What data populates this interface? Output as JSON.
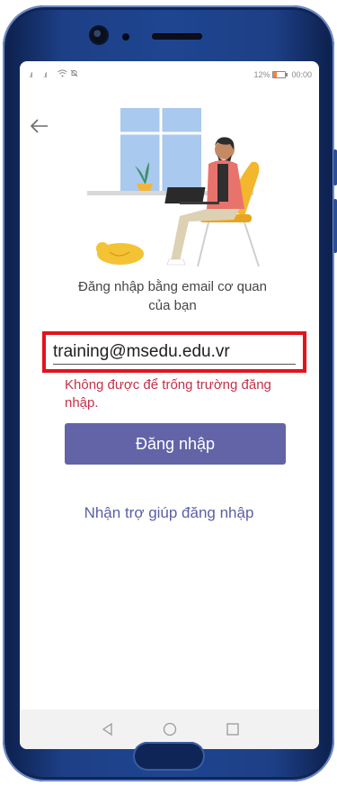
{
  "status_bar": {
    "signal_1": ".ıl",
    "signal_2": ".ıl",
    "battery_percent": "12%",
    "time": "00:00"
  },
  "signin": {
    "title": "Đăng nhập bằng email cơ quan của bạn",
    "email_value": "training@msedu.edu.vr",
    "error_message": "Không được để trống trường đăng nhập.",
    "signin_button": "Đăng nhập",
    "help_link": "Nhận trợ giúp đăng nhập"
  },
  "icons": {
    "back": "back-arrow-icon",
    "nav_back": "triangle-back-icon",
    "nav_home": "circle-home-icon",
    "nav_recent": "square-recent-icon"
  },
  "colors": {
    "accent": "#6264a7",
    "error": "#c4314b",
    "highlight_border": "#e3131c",
    "phone_body": "#1f4591"
  }
}
